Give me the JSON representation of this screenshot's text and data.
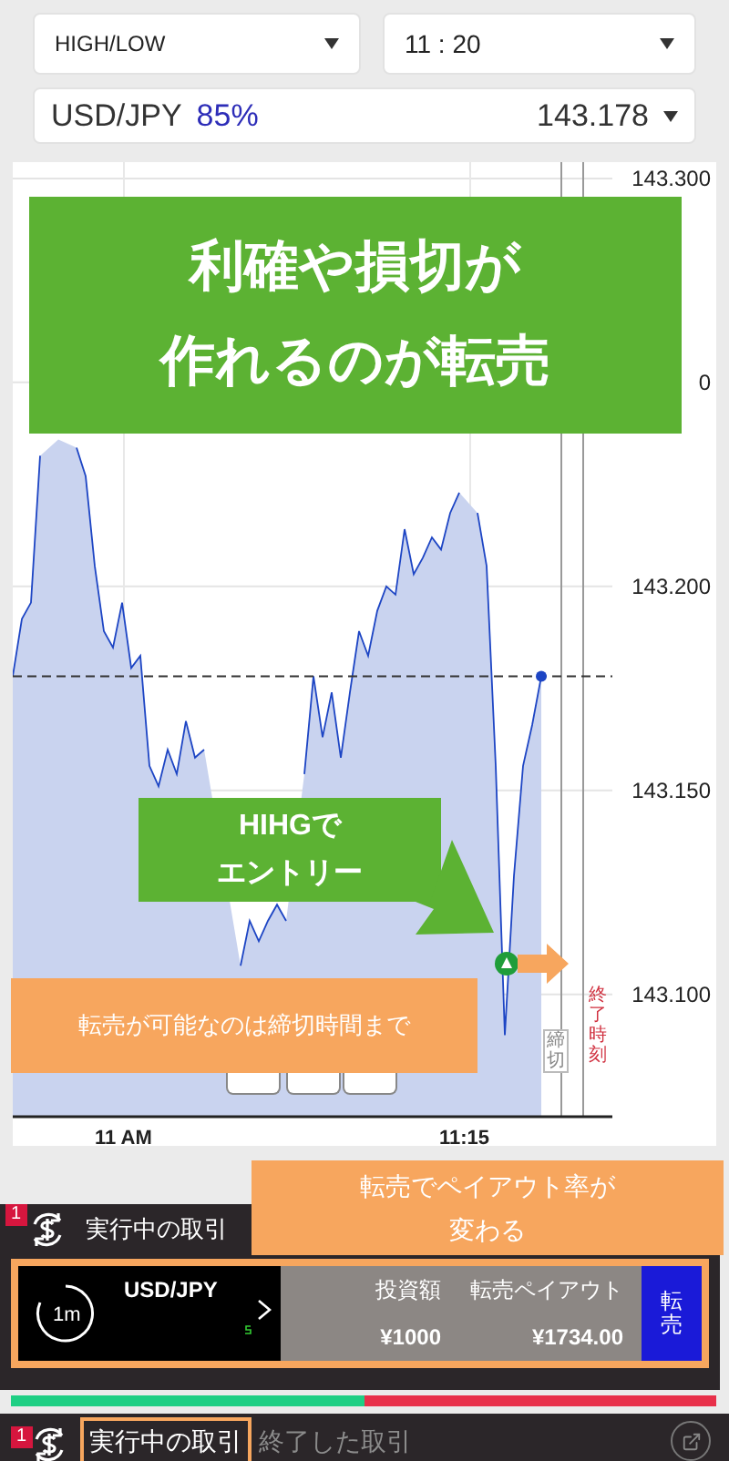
{
  "trade_type": {
    "value": "HIGH/LOW"
  },
  "expiry": {
    "value": "11 : 20"
  },
  "asset": {
    "name": "USD/JPY",
    "payout_rate": "85%",
    "price": "143.178"
  },
  "chart": {
    "chart_data": {
      "type": "area",
      "series": [
        {
          "color": "#1d45c4",
          "values": [
            143.178,
            143.192,
            143.196,
            143.232,
            null,
            143.236,
            null,
            143.234,
            143.227,
            143.205,
            143.189,
            143.185,
            143.196,
            143.18,
            143.183,
            143.156,
            143.151,
            143.16,
            143.154,
            143.167,
            143.158,
            143.16,
            null,
            null,
            null,
            143.107,
            143.118,
            143.113,
            143.118,
            143.122,
            143.118,
            null,
            143.154,
            143.178,
            143.163,
            143.174,
            143.158,
            143.174,
            143.189,
            143.183,
            143.194,
            143.2,
            143.198,
            143.214,
            143.203,
            143.207,
            143.212,
            143.209,
            143.218,
            143.223,
            null,
            143.218,
            143.205,
            143.156,
            143.09,
            143.129,
            143.156,
            143.166,
            143.178
          ]
        }
      ],
      "ylim": [
        143.07,
        143.304
      ],
      "grid": true,
      "yticks": [
        {
          "value": 143.3,
          "label": "143.300"
        },
        {
          "value": 143.2,
          "label": "143.200"
        },
        {
          "value": 143.15,
          "label": "143.150"
        },
        {
          "value": 143.1,
          "label": "143.100"
        }
      ]
    },
    "covered_tick_label": "0",
    "x_labels": [
      "11 AM",
      "11:15"
    ],
    "deadline_label": "締切",
    "expiry_label": "終了時刻"
  },
  "annotations": [
    {
      "kind": "banner",
      "lines": [
        "利確や損切が",
        "作れるのが転売"
      ]
    },
    {
      "kind": "callout",
      "lines": [
        "HIHGで",
        "エントリー"
      ]
    },
    {
      "kind": "note",
      "lines": [
        "転売が可能なのは締切時間まで"
      ]
    },
    {
      "kind": "note",
      "lines": [
        "転売でペイアウト率が",
        "変わる"
      ]
    }
  ],
  "open_trades": {
    "badge": "1",
    "label": "実行中の取引"
  },
  "trade": {
    "duration": "1m",
    "asset": "USD/JPY",
    "amount_label": "投資額",
    "amount": "¥1000",
    "payout_label": "転売ペイアウト",
    "payout": "¥1734.00",
    "sell_button": "転売"
  },
  "sentiment": {
    "level": 0.5
  },
  "tab_badge": "1",
  "tabs": [
    {
      "label": "実行中の取引",
      "selected": true
    },
    {
      "label": "終了した取引",
      "selected": false
    }
  ]
}
